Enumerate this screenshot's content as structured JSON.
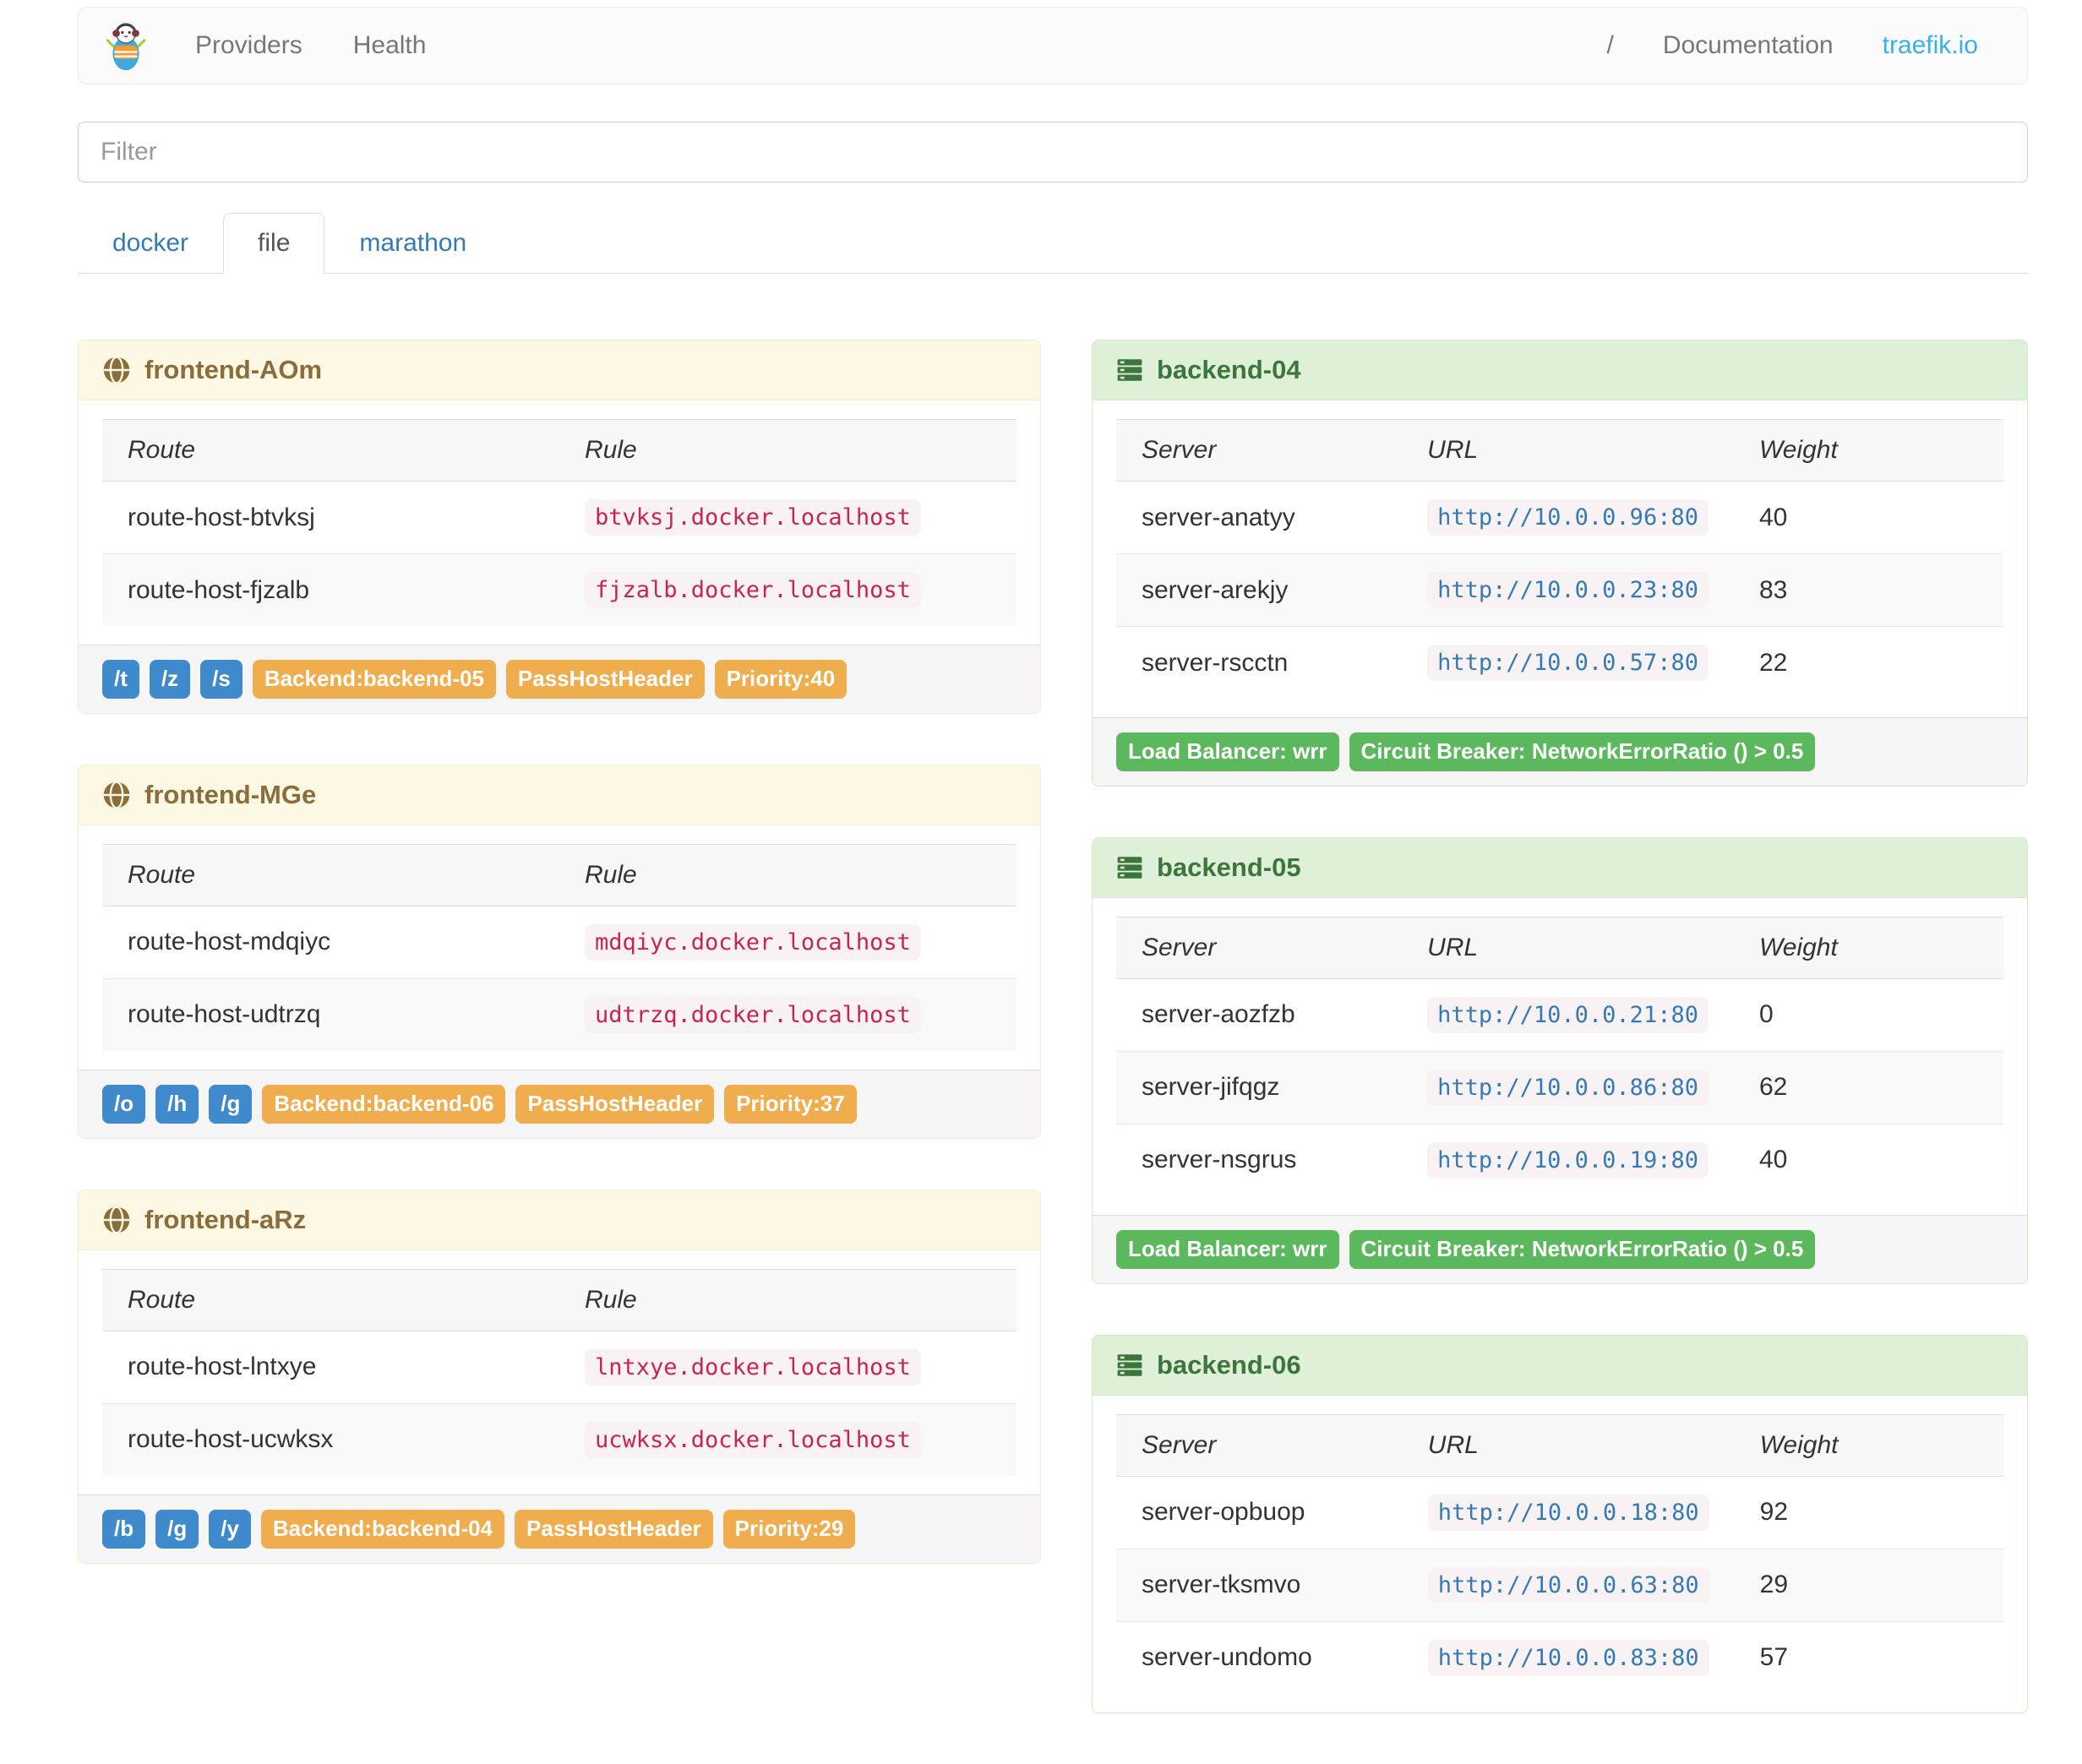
{
  "navbar": {
    "providers": "Providers",
    "health": "Health",
    "separator": "/",
    "documentation": "Documentation",
    "site": "traefik.io"
  },
  "filter": {
    "placeholder": "Filter"
  },
  "tabs": [
    {
      "label": "docker",
      "active": false
    },
    {
      "label": "file",
      "active": true
    },
    {
      "label": "marathon",
      "active": false
    }
  ],
  "frontend_headers": {
    "route": "Route",
    "rule": "Rule"
  },
  "backend_headers": {
    "server": "Server",
    "url": "URL",
    "weight": "Weight"
  },
  "frontends": [
    {
      "name": "frontend-AOm",
      "icon": "globe-icon",
      "rows": [
        {
          "route": "route-host-btvksj",
          "rule": "btvksj.docker.localhost"
        },
        {
          "route": "route-host-fjzalb",
          "rule": "fjzalb.docker.localhost"
        }
      ],
      "path_badges": [
        "/t",
        "/z",
        "/s"
      ],
      "backend_badge": "Backend:backend-05",
      "passhost_badge": "PassHostHeader",
      "priority_badge": "Priority:40"
    },
    {
      "name": "frontend-MGe",
      "icon": "globe-icon",
      "rows": [
        {
          "route": "route-host-mdqiyc",
          "rule": "mdqiyc.docker.localhost"
        },
        {
          "route": "route-host-udtrzq",
          "rule": "udtrzq.docker.localhost"
        }
      ],
      "path_badges": [
        "/o",
        "/h",
        "/g"
      ],
      "backend_badge": "Backend:backend-06",
      "passhost_badge": "PassHostHeader",
      "priority_badge": "Priority:37"
    },
    {
      "name": "frontend-aRz",
      "icon": "globe-icon",
      "rows": [
        {
          "route": "route-host-lntxye",
          "rule": "lntxye.docker.localhost"
        },
        {
          "route": "route-host-ucwksx",
          "rule": "ucwksx.docker.localhost"
        }
      ],
      "path_badges": [
        "/b",
        "/g",
        "/y"
      ],
      "backend_badge": "Backend:backend-04",
      "passhost_badge": "PassHostHeader",
      "priority_badge": "Priority:29"
    }
  ],
  "backends": [
    {
      "name": "backend-04",
      "icon": "servers-icon",
      "rows": [
        {
          "server": "server-anatyy",
          "url": "http://10.0.0.96:80",
          "weight": "40"
        },
        {
          "server": "server-arekjy",
          "url": "http://10.0.0.23:80",
          "weight": "83"
        },
        {
          "server": "server-rscctn",
          "url": "http://10.0.0.57:80",
          "weight": "22"
        }
      ],
      "lb_badge": "Load Balancer: wrr",
      "cb_badge": "Circuit Breaker: NetworkErrorRatio () > 0.5"
    },
    {
      "name": "backend-05",
      "icon": "servers-icon",
      "rows": [
        {
          "server": "server-aozfzb",
          "url": "http://10.0.0.21:80",
          "weight": "0"
        },
        {
          "server": "server-jifqgz",
          "url": "http://10.0.0.86:80",
          "weight": "62"
        },
        {
          "server": "server-nsgrus",
          "url": "http://10.0.0.19:80",
          "weight": "40"
        }
      ],
      "lb_badge": "Load Balancer: wrr",
      "cb_badge": "Circuit Breaker: NetworkErrorRatio () > 0.5"
    },
    {
      "name": "backend-06",
      "icon": "servers-icon",
      "rows": [
        {
          "server": "server-opbuop",
          "url": "http://10.0.0.18:80",
          "weight": "92"
        },
        {
          "server": "server-tksmvo",
          "url": "http://10.0.0.63:80",
          "weight": "29"
        },
        {
          "server": "server-undomo",
          "url": "http://10.0.0.83:80",
          "weight": "57"
        }
      ]
    }
  ],
  "colors": {
    "primary_badge": "#3e8acc",
    "warning_badge": "#f0ad4e",
    "success_badge": "#5cb85c",
    "code_text": "#c7254e",
    "code_bg": "#f9f2f4",
    "url_link": "#337ab7",
    "frontend_heading_bg": "#fcf8e3",
    "frontend_heading_text": "#8a6d3b",
    "backend_heading_bg": "#dff0d8",
    "backend_heading_text": "#3c763d",
    "site_link": "#36b3e5"
  }
}
